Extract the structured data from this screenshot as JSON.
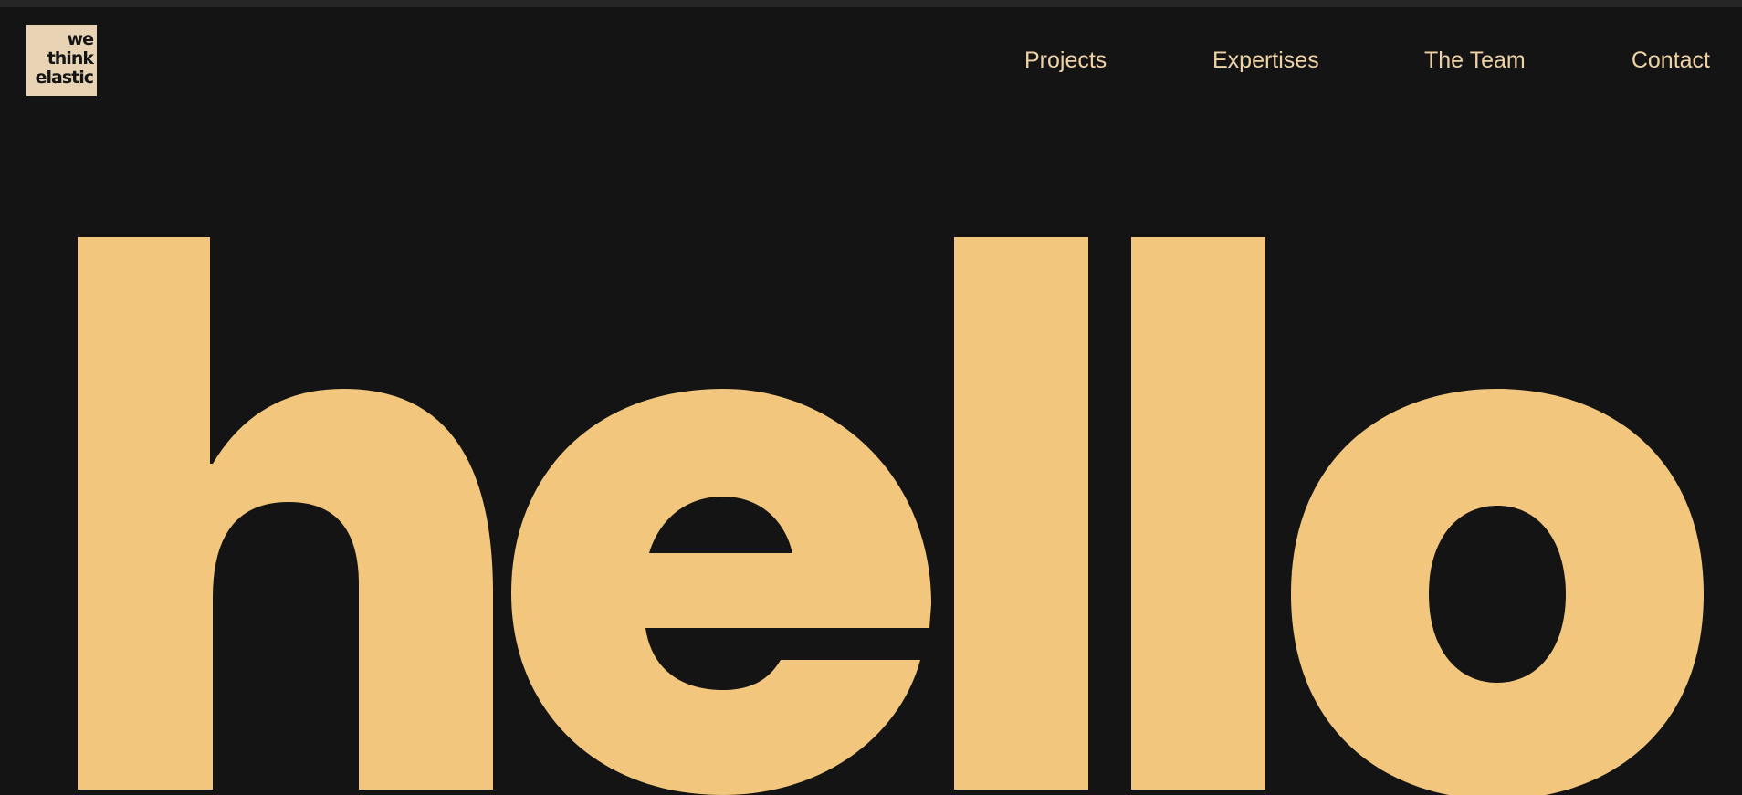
{
  "logo": {
    "lines": [
      "we",
      "think",
      "elastic"
    ]
  },
  "nav": {
    "items": [
      "Projects",
      "Expertises",
      "The Team",
      "Contact"
    ]
  },
  "hero": {
    "word": "hello"
  },
  "colors": {
    "background": "#141414",
    "accent": "#f2c77d",
    "nav_text": "#eed2a6",
    "logo_bg": "#e8d4b4"
  }
}
